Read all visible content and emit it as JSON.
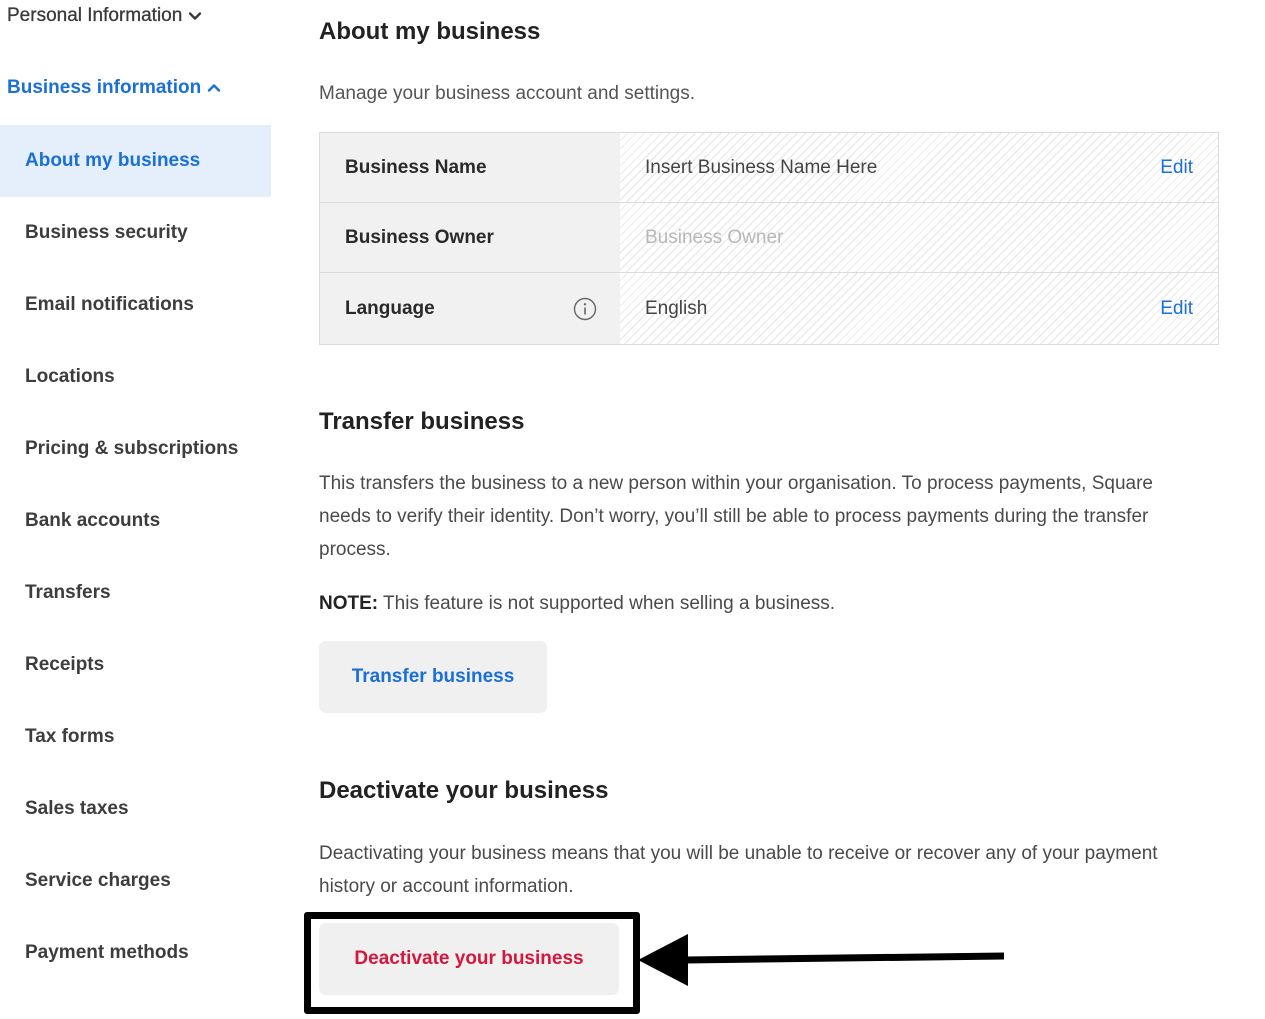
{
  "sidebar": {
    "personal_section": {
      "label": "Personal Information",
      "icon": "chevron-down-icon",
      "expanded": false
    },
    "business_section": {
      "label": "Business information",
      "icon": "chevron-up-icon",
      "expanded": true
    },
    "items": [
      {
        "label": "About my business",
        "active": true
      },
      {
        "label": "Business security",
        "active": false
      },
      {
        "label": "Email notifications",
        "active": false
      },
      {
        "label": "Locations",
        "active": false
      },
      {
        "label": "Pricing & subscriptions",
        "active": false
      },
      {
        "label": "Bank accounts",
        "active": false
      },
      {
        "label": "Transfers",
        "active": false
      },
      {
        "label": "Receipts",
        "active": false
      },
      {
        "label": "Tax forms",
        "active": false
      },
      {
        "label": "Sales taxes",
        "active": false
      },
      {
        "label": "Service charges",
        "active": false
      },
      {
        "label": "Payment methods",
        "active": false
      }
    ]
  },
  "main": {
    "title": "About my business",
    "subtitle": "Manage your business account and settings.",
    "details": [
      {
        "label": "Business Name",
        "value": "Insert Business Name Here",
        "is_placeholder": false,
        "action": "Edit",
        "info_icon": false
      },
      {
        "label": "Business Owner",
        "value": "Business Owner",
        "is_placeholder": true,
        "action": null,
        "info_icon": false
      },
      {
        "label": "Language",
        "value": "English",
        "is_placeholder": false,
        "action": "Edit",
        "info_icon": true
      }
    ],
    "transfer": {
      "heading": "Transfer business",
      "description": "This transfers the business to a new person within your organisation. To process payments, Square needs to verify their identity. Don’t worry, you’ll still be able to process payments during the transfer process.",
      "note_label": "NOTE:",
      "note_text": " This feature is not supported when selling a business.",
      "button_label": "Transfer business"
    },
    "deactivate": {
      "heading": "Deactivate your business",
      "description": "Deactivating your business means that you will be unable to receive or recover any of your payment history or account information.",
      "button_label": "Deactivate your business"
    }
  },
  "colors": {
    "accent_blue": "#1a6fd8",
    "danger_red": "#d6163a",
    "active_bg": "#e5effc",
    "label_bg": "#f1f1f1",
    "button_bg": "#f0f0f0",
    "annotation": "#000000"
  },
  "annotation": {
    "highlight_target": "deactivate-business-button",
    "arrow_direction": "left"
  }
}
